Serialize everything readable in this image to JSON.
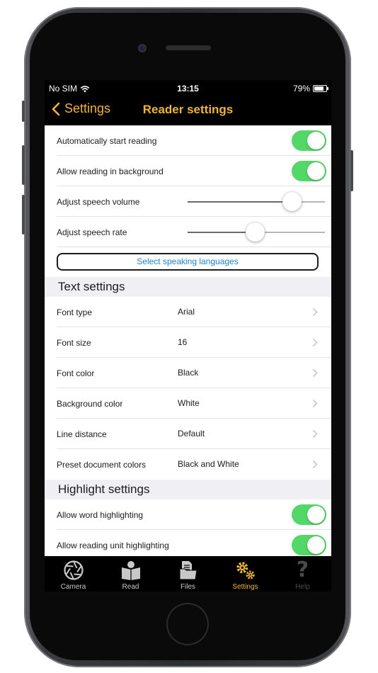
{
  "status_bar": {
    "carrier": "No SIM",
    "time": "13:15",
    "battery": "79%",
    "battery_level": 0.79
  },
  "nav": {
    "back_label": "Settings",
    "title": "Reader settings"
  },
  "reading": {
    "auto_start": {
      "label": "Automatically start reading",
      "on": true
    },
    "background": {
      "label": "Allow reading in background",
      "on": true
    },
    "volume": {
      "label": "Adjust speech volume",
      "level": 0.76
    },
    "rate": {
      "label": "Adjust speech rate",
      "level": 0.49
    },
    "languages_button": "Select speaking languages"
  },
  "text_settings": {
    "header": "Text settings",
    "rows": [
      {
        "label": "Font type",
        "value": "Arial"
      },
      {
        "label": "Font size",
        "value": "16"
      },
      {
        "label": "Font color",
        "value": "Black"
      },
      {
        "label": "Background color",
        "value": "White"
      },
      {
        "label": "Line distance",
        "value": "Default"
      },
      {
        "label": "Preset document colors",
        "value": "Black and White"
      }
    ]
  },
  "highlight_settings": {
    "header": "Highlight settings",
    "word": {
      "label": "Allow word highlighting",
      "on": true
    },
    "unit": {
      "label": "Allow reading unit highlighting",
      "on": true
    }
  },
  "tabs": [
    {
      "label": "Camera",
      "icon": "camera-icon",
      "active": false
    },
    {
      "label": "Read",
      "icon": "read-icon",
      "active": false
    },
    {
      "label": "Files",
      "icon": "files-icon",
      "active": false
    },
    {
      "label": "Settings",
      "icon": "settings-icon",
      "active": true
    },
    {
      "label": "Help",
      "icon": "help-icon",
      "active": false
    }
  ],
  "colors": {
    "accent": "#f0b536",
    "toggle_on": "#53d769",
    "link": "#1d82cc",
    "tab_inactive": "#c8c8c8",
    "tab_disabled": "#4a4a4a"
  }
}
